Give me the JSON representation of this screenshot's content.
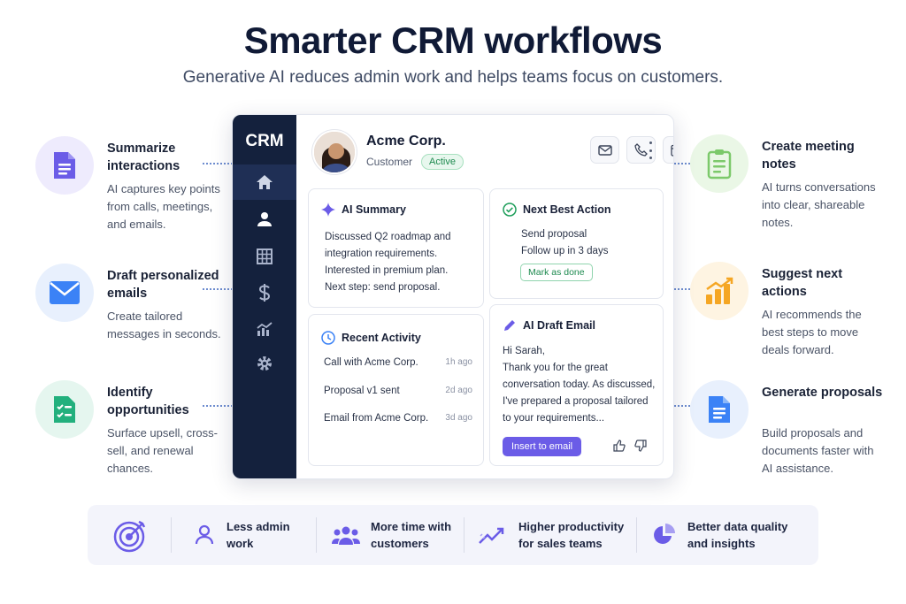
{
  "title": "Smarter CRM workflows",
  "subtitle": "Generative AI reduces admin work and helps teams focus on customers.",
  "left_features": [
    {
      "title": "Summarize interactions",
      "desc": "AI captures key points from calls, meetings, and emails.",
      "icon": "document-icon",
      "color": "#6b5ce7"
    },
    {
      "title": "Draft personalized emails",
      "desc": "Create tailored messages in seconds.",
      "icon": "mail-icon",
      "color": "#3b82f6"
    },
    {
      "title": "Identify opportunities",
      "desc": "Surface upsell, cross-sell, and renewal chances.",
      "icon": "checklist-icon",
      "color": "#22b07d"
    }
  ],
  "right_features": [
    {
      "title": "Create meeting notes",
      "desc": "AI turns conversations into clear, shareable notes.",
      "icon": "clipboard-icon",
      "color": "#7cc96b"
    },
    {
      "title": "Suggest next actions",
      "desc": "AI recommends the best steps to move deals forward.",
      "icon": "bar-chart-icon",
      "color": "#f5a623"
    },
    {
      "title": "Generate proposals",
      "desc": "Build proposals and documents faster with AI assistance.",
      "icon": "proposal-icon",
      "color": "#3b82f6"
    }
  ],
  "crm": {
    "logo": "CRM",
    "nav": [
      "home-icon",
      "user-icon",
      "grid-icon",
      "dollar-icon",
      "analytics-icon",
      "settings-icon"
    ],
    "company": "Acme Corp.",
    "type": "Customer",
    "status": "Active",
    "ai_summary": {
      "title": "AI Summary",
      "lines": [
        "Discussed Q2 roadmap and",
        "integration requirements.",
        "Interested in premium plan.",
        "Next step: send proposal."
      ]
    },
    "next_best_action": {
      "title": "Next Best Action",
      "lines": [
        "Send proposal",
        "Follow up in 3 days"
      ],
      "button": "Mark as done"
    },
    "recent_activity": {
      "title": "Recent Activity",
      "items": [
        {
          "text": "Call with Acme Corp.",
          "time": "1h ago"
        },
        {
          "text": "Proposal v1 sent",
          "time": "2d ago"
        },
        {
          "text": "Email from Acme Corp.",
          "time": "3d ago"
        }
      ]
    },
    "ai_draft": {
      "title": "AI Draft Email",
      "lines": [
        "Hi Sarah,",
        "Thank you for the great",
        "conversation today. As discussed,",
        "I've prepared a proposal tailored",
        "to your requirements..."
      ],
      "button": "Insert to email"
    }
  },
  "benefits": [
    {
      "line1": "Less admin",
      "line2": "work",
      "icon": "user-outline-icon"
    },
    {
      "line1": "More time with",
      "line2": "customers",
      "icon": "team-icon"
    },
    {
      "line1": "Higher productivity",
      "line2": "for sales teams",
      "icon": "trend-up-icon"
    },
    {
      "line1": "Better data quality",
      "line2": "and insights",
      "icon": "pie-chart-icon"
    }
  ],
  "colors": {
    "accent": "#6b5ce7",
    "sidebar": "#14213d",
    "success": "#1e8a4f"
  }
}
